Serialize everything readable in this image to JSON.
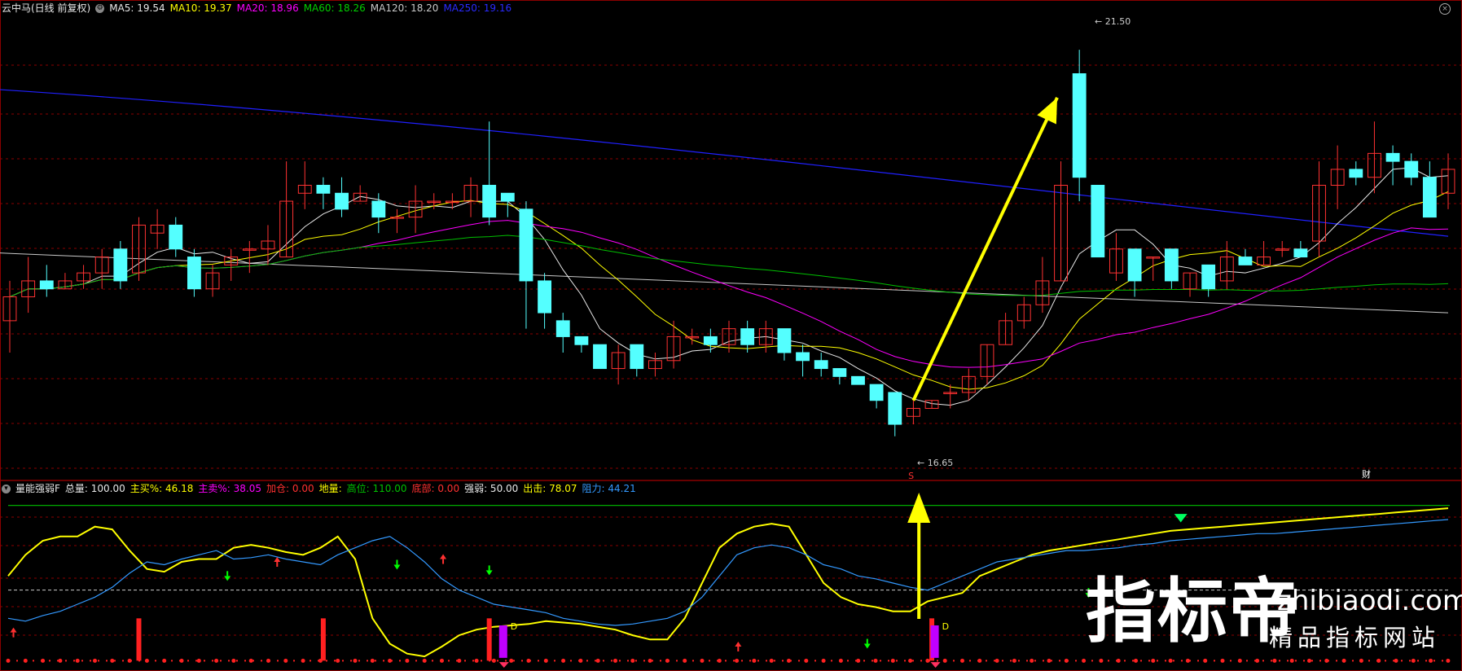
{
  "main_legend": {
    "name": "云中马(日线 前复权)",
    "items": [
      {
        "label": "MA5: 19.54",
        "color": "#e8e8e8"
      },
      {
        "label": "MA10: 19.37",
        "color": "#ffff00"
      },
      {
        "label": "MA20: 18.96",
        "color": "#ff00ff"
      },
      {
        "label": "MA60: 18.26",
        "color": "#00d000"
      },
      {
        "label": "MA120: 18.20",
        "color": "#c8c8c8"
      },
      {
        "label": "MA250: 19.16",
        "color": "#0000ff"
      }
    ]
  },
  "sub_legend": {
    "name": "量能强弱F",
    "items": [
      {
        "label": "总量: 100.00",
        "color": "#e8e8e8"
      },
      {
        "label": "主买%: 46.18",
        "color": "#ffff00"
      },
      {
        "label": "主卖%: 38.05",
        "color": "#ff00ff"
      },
      {
        "label": "加仓: 0.00",
        "color": "#ff3030"
      },
      {
        "label": "地量: ",
        "color": "#ffff00"
      },
      {
        "label": "高位: 110.00",
        "color": "#00c000"
      },
      {
        "label": "底部: 0.00",
        "color": "#ff3030"
      },
      {
        "label": "强弱: 50.00",
        "color": "#e8e8e8"
      },
      {
        "label": "出击: 78.07",
        "color": "#ffff00"
      },
      {
        "label": "阻力: 44.21",
        "color": "#3399ff"
      }
    ]
  },
  "labels": {
    "high": "21.50",
    "low": "16.65",
    "marker_d": "D",
    "marker_s": "S",
    "cai": "财"
  },
  "watermark": {
    "big": "指标帝",
    "url": "zhibiaodi.com",
    "sub": "精品指标网站"
  },
  "colors": {
    "up": "#ff3232",
    "down": "#54ffff",
    "grid": "#8b0000",
    "arrow": "#ffff00"
  },
  "chart_data": [
    {
      "type": "candlestick",
      "title": "云中马(日线 前复权)",
      "ylim": [
        16.3,
        21.9
      ],
      "candles": [
        [
          18.1,
          18.4,
          17.7,
          18.6
        ],
        [
          18.4,
          18.6,
          18.2,
          18.9
        ],
        [
          18.6,
          18.5,
          18.4,
          18.8
        ],
        [
          18.5,
          18.6,
          18.5,
          18.7
        ],
        [
          18.6,
          18.7,
          18.5,
          18.8
        ],
        [
          18.7,
          18.9,
          18.5,
          19.0
        ],
        [
          19.0,
          18.6,
          18.5,
          19.1
        ],
        [
          18.7,
          19.3,
          18.6,
          19.4
        ],
        [
          19.2,
          19.3,
          19.0,
          19.5
        ],
        [
          19.3,
          19.0,
          18.9,
          19.4
        ],
        [
          18.9,
          18.5,
          18.4,
          19.0
        ],
        [
          18.5,
          18.7,
          18.4,
          18.8
        ],
        [
          18.8,
          18.9,
          18.6,
          19.0
        ],
        [
          19.0,
          19.0,
          18.7,
          19.1
        ],
        [
          19.0,
          19.1,
          18.8,
          19.3
        ],
        [
          18.9,
          19.6,
          18.9,
          20.1
        ],
        [
          19.7,
          19.8,
          19.5,
          20.1
        ],
        [
          19.8,
          19.7,
          19.5,
          19.9
        ],
        [
          19.7,
          19.5,
          19.4,
          19.9
        ],
        [
          19.6,
          19.7,
          19.6,
          19.8
        ],
        [
          19.6,
          19.4,
          19.2,
          19.7
        ],
        [
          19.4,
          19.4,
          19.2,
          19.5
        ],
        [
          19.4,
          19.6,
          19.2,
          19.8
        ],
        [
          19.6,
          19.6,
          19.5,
          19.7
        ],
        [
          19.6,
          19.6,
          19.5,
          19.7
        ],
        [
          19.6,
          19.8,
          19.4,
          19.9
        ],
        [
          19.8,
          19.4,
          19.3,
          20.6
        ],
        [
          19.7,
          19.6,
          19.4,
          19.7
        ],
        [
          19.5,
          18.6,
          18.0,
          19.6
        ],
        [
          18.6,
          18.2,
          18.0,
          18.7
        ],
        [
          18.1,
          17.9,
          17.7,
          18.2
        ],
        [
          17.9,
          17.8,
          17.7,
          17.9
        ],
        [
          17.8,
          17.5,
          17.5,
          17.8
        ],
        [
          17.5,
          17.7,
          17.3,
          17.8
        ],
        [
          17.8,
          17.5,
          17.4,
          17.8
        ],
        [
          17.5,
          17.6,
          17.4,
          17.7
        ],
        [
          17.6,
          17.9,
          17.5,
          18.1
        ],
        [
          17.9,
          17.9,
          17.8,
          18.0
        ],
        [
          17.9,
          17.8,
          17.7,
          18.0
        ],
        [
          17.8,
          18.0,
          17.7,
          18.1
        ],
        [
          18.0,
          17.8,
          17.7,
          18.1
        ],
        [
          17.8,
          18.0,
          17.7,
          18.1
        ],
        [
          18.0,
          17.7,
          17.6,
          18.0
        ],
        [
          17.7,
          17.6,
          17.4,
          17.8
        ],
        [
          17.6,
          17.5,
          17.4,
          17.7
        ],
        [
          17.5,
          17.4,
          17.3,
          17.5
        ],
        [
          17.4,
          17.3,
          17.3,
          17.4
        ],
        [
          17.3,
          17.1,
          17.0,
          17.3
        ],
        [
          17.2,
          16.8,
          16.65,
          17.2
        ],
        [
          16.9,
          17.0,
          16.8,
          17.1
        ],
        [
          17.0,
          17.1,
          17.0,
          17.1
        ],
        [
          17.2,
          17.2,
          17.0,
          17.3
        ],
        [
          17.2,
          17.4,
          17.1,
          17.5
        ],
        [
          17.4,
          17.8,
          17.3,
          17.8
        ],
        [
          17.8,
          18.1,
          17.8,
          18.2
        ],
        [
          18.1,
          18.3,
          18.0,
          18.4
        ],
        [
          18.3,
          18.6,
          18.2,
          18.9
        ],
        [
          18.6,
          19.8,
          18.6,
          20.1
        ],
        [
          21.2,
          19.9,
          19.6,
          21.5
        ],
        [
          19.8,
          18.9,
          18.9,
          19.8
        ],
        [
          18.7,
          19.0,
          18.6,
          19.2
        ],
        [
          19.0,
          18.6,
          18.4,
          19.0
        ],
        [
          18.9,
          18.9,
          18.6,
          18.9
        ],
        [
          19.0,
          18.6,
          18.5,
          19.0
        ],
        [
          18.5,
          18.7,
          18.4,
          18.7
        ],
        [
          18.8,
          18.5,
          18.4,
          18.8
        ],
        [
          18.6,
          18.9,
          18.5,
          19.1
        ],
        [
          18.9,
          18.8,
          18.8,
          19.0
        ],
        [
          18.8,
          18.9,
          18.8,
          19.1
        ],
        [
          19.0,
          19.0,
          18.9,
          19.1
        ],
        [
          19.0,
          18.9,
          18.9,
          19.1
        ],
        [
          19.1,
          19.8,
          18.9,
          20.1
        ],
        [
          19.8,
          20.0,
          19.5,
          20.3
        ],
        [
          20.0,
          19.9,
          19.8,
          20.1
        ],
        [
          19.9,
          20.2,
          19.7,
          20.6
        ],
        [
          20.2,
          20.1,
          19.8,
          20.3
        ],
        [
          20.1,
          19.9,
          19.8,
          20.2
        ],
        [
          19.9,
          19.4,
          19.4,
          20.1
        ],
        [
          19.7,
          20.0,
          19.5,
          20.2
        ]
      ]
    },
    {
      "type": "line",
      "title": "量能强弱F",
      "ylim": [
        -5,
        115
      ],
      "series": [
        {
          "name": "出击",
          "values": [
            60,
            75,
            85,
            88,
            88,
            95,
            93,
            78,
            65,
            63,
            70,
            72,
            72,
            80,
            82,
            80,
            77,
            75,
            80,
            88,
            72,
            30,
            12,
            5,
            3,
            10,
            18,
            22,
            24,
            25,
            26,
            28,
            27,
            26,
            24,
            22,
            18,
            15,
            15,
            30,
            55,
            80,
            90,
            95,
            97,
            95,
            75,
            55,
            45,
            40,
            38,
            35,
            35,
            42,
            45,
            48,
            60,
            65,
            70,
            75,
            78,
            80,
            82,
            84,
            86,
            88,
            90,
            92,
            93,
            94,
            95,
            96,
            97,
            98,
            99,
            100,
            101,
            102,
            103,
            104,
            105,
            106,
            107,
            108
          ]
        },
        {
          "name": "阻力",
          "values": [
            30,
            28,
            32,
            35,
            40,
            45,
            52,
            62,
            70,
            68,
            72,
            75,
            78,
            72,
            73,
            75,
            72,
            70,
            68,
            75,
            80,
            85,
            88,
            80,
            70,
            58,
            50,
            45,
            40,
            38,
            36,
            34,
            30,
            28,
            26,
            25,
            26,
            28,
            30,
            35,
            45,
            60,
            75,
            80,
            82,
            80,
            75,
            68,
            65,
            60,
            58,
            55,
            52,
            50,
            55,
            60,
            65,
            70,
            72,
            74,
            76,
            78,
            78,
            79,
            80,
            82,
            83,
            85,
            86,
            87,
            88,
            89,
            90,
            90,
            91,
            92,
            93,
            94,
            95,
            96,
            97,
            98,
            99,
            100
          ]
        }
      ],
      "signal_bars": [
        7,
        17,
        26,
        50
      ]
    }
  ]
}
